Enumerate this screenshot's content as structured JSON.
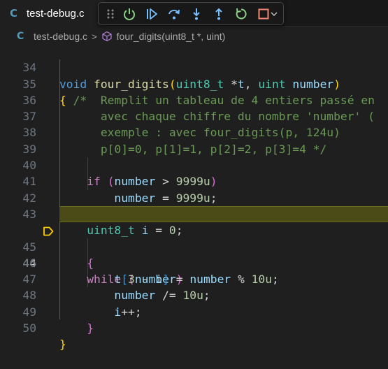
{
  "tab": {
    "icon": "C",
    "label": "test-debug.c"
  },
  "debug_toolbar": {
    "buttons": [
      "drag-handle",
      "continue",
      "step-over",
      "step-into",
      "step-out",
      "restart",
      "stop",
      "more"
    ],
    "colors": {
      "continue": "#89d185",
      "step": "#75beff",
      "stop": "#f48771"
    }
  },
  "breadcrumb": {
    "file_icon": "C",
    "file": "test-debug.c",
    "separator": ">",
    "symbol": "four_digits(uint8_t *, uint)"
  },
  "editor": {
    "active_line": "44",
    "lines": [
      {
        "n": "34",
        "code": "void four_digits(uint8_t *t, uint number)"
      },
      {
        "n": "35",
        "code": "{ /*  Remplit un tableau de 4 entiers passé en"
      },
      {
        "n": "36",
        "code": "      avec chaque chiffre du nombre 'number' ("
      },
      {
        "n": "37",
        "code": "      exemple : avec four_digits(p, 124u)"
      },
      {
        "n": "38",
        "code": "      p[0]=0, p[1]=1, p[2]=2, p[3]=4 */"
      },
      {
        "n": "39",
        "code": ""
      },
      {
        "n": "40",
        "code": "    if (number > 9999u)"
      },
      {
        "n": "41",
        "code": "        number = 9999u;"
      },
      {
        "n": "42",
        "code": ""
      },
      {
        "n": "43",
        "code": "    uint8_t i = 0;"
      },
      {
        "n": "44",
        "code": "    while (number)"
      },
      {
        "n": "45",
        "code": "    {"
      },
      {
        "n": "46",
        "code": "        t[3 - i] = number % 10u;"
      },
      {
        "n": "47",
        "code": "        number /= 10u;"
      },
      {
        "n": "48",
        "code": "        i++;"
      },
      {
        "n": "49",
        "code": "    }"
      },
      {
        "n": "50",
        "code": "}"
      }
    ]
  }
}
